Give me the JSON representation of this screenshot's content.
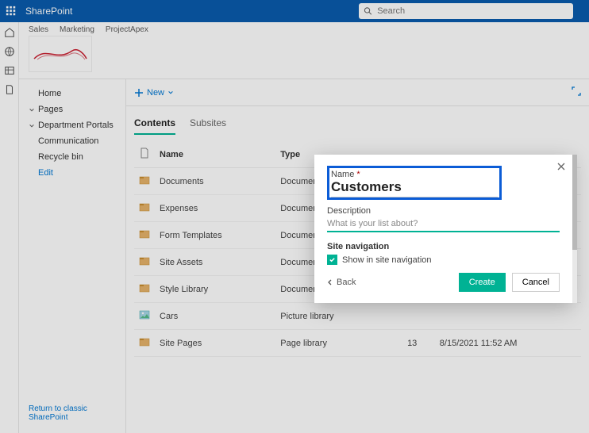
{
  "topbar": {
    "brand": "SharePoint",
    "search_placeholder": "Search"
  },
  "site_links": [
    "Sales",
    "Marketing",
    "ProjectApex"
  ],
  "leftnav": {
    "items": [
      {
        "label": "Home",
        "expandable": false
      },
      {
        "label": "Pages",
        "expandable": true
      },
      {
        "label": "Department Portals",
        "expandable": true
      },
      {
        "label": "Communication",
        "expandable": false,
        "sub": true
      },
      {
        "label": "Recycle bin",
        "expandable": false
      },
      {
        "label": "Edit",
        "expandable": false,
        "edit": true
      }
    ],
    "classic_link": "Return to classic SharePoint"
  },
  "cmdbar": {
    "new_label": "New"
  },
  "tabs": [
    {
      "label": "Contents",
      "active": true
    },
    {
      "label": "Subsites",
      "active": false
    }
  ],
  "list": {
    "headers": {
      "name": "Name",
      "type": "Type",
      "items": "",
      "modified": ""
    },
    "rows": [
      {
        "icon": "docs",
        "name": "Documents",
        "type": "Document library",
        "items": "",
        "modified": ""
      },
      {
        "icon": "docs",
        "name": "Expenses",
        "type": "Document library",
        "items": "",
        "modified": ""
      },
      {
        "icon": "docs",
        "name": "Form Templates",
        "type": "Document library",
        "items": "",
        "modified": ""
      },
      {
        "icon": "docs",
        "name": "Site Assets",
        "type": "Document library",
        "items": "",
        "modified": ""
      },
      {
        "icon": "docs",
        "name": "Style Library",
        "type": "Document library",
        "items": "",
        "modified": ""
      },
      {
        "icon": "pics",
        "name": "Cars",
        "type": "Picture library",
        "items": "",
        "modified": ""
      },
      {
        "icon": "docs",
        "name": "Site Pages",
        "type": "Page library",
        "items": "13",
        "modified": "8/15/2021 11:52 AM"
      }
    ]
  },
  "dialog": {
    "name_label": "Name",
    "name_value": "Customers",
    "desc_label": "Description",
    "desc_placeholder": "What is your list about?",
    "nav_section": "Site navigation",
    "nav_checkbox_label": "Show in site navigation",
    "back_label": "Back",
    "create_label": "Create",
    "cancel_label": "Cancel"
  }
}
